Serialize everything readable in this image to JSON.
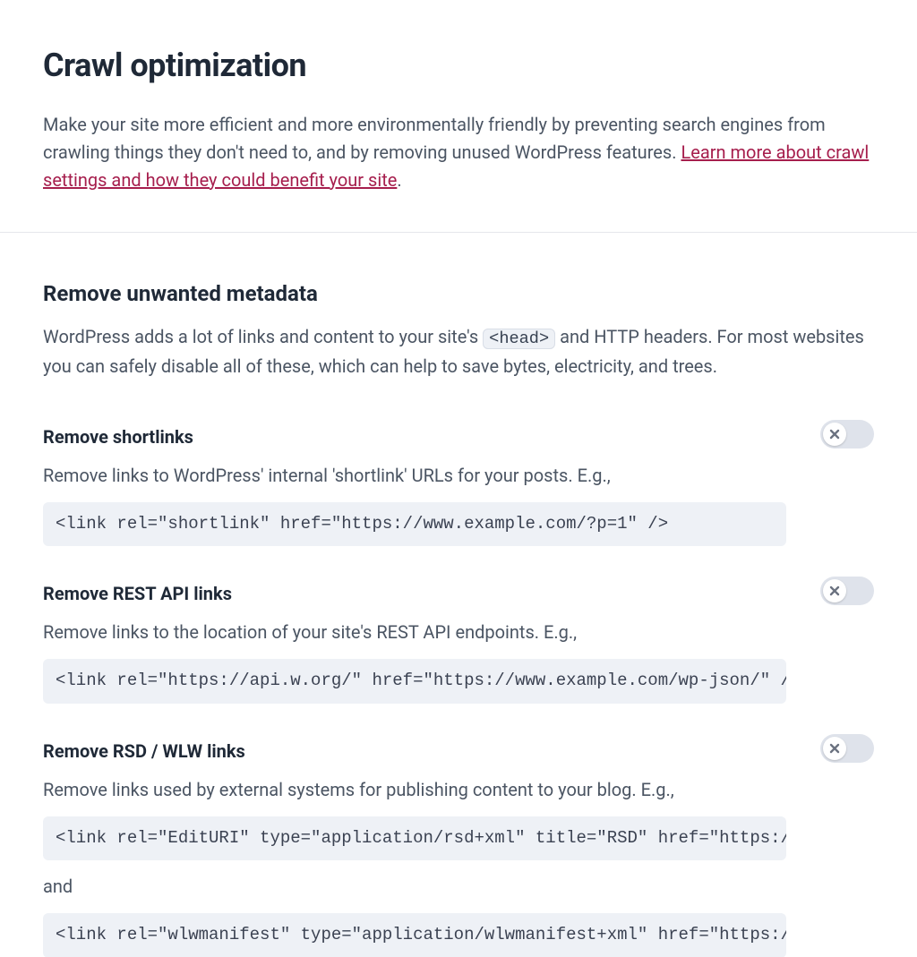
{
  "header": {
    "title": "Crawl optimization",
    "intro_pre": "Make your site more efficient and more environmentally friendly by preventing search engines from crawling things they don't need to, and by removing unused WordPress features. ",
    "learn_more": "Learn more about crawl settings and how they could benefit your site",
    "period": "."
  },
  "section": {
    "title": "Remove unwanted metadata",
    "intro_pre": "WordPress adds a lot of links and content to your site's ",
    "head_tag": "<head>",
    "intro_post": " and HTTP headers. For most websites you can safely disable all of these, which can help to save bytes, electricity, and trees."
  },
  "settings": [
    {
      "title": "Remove shortlinks",
      "desc": "Remove links to WordPress' internal 'shortlink' URLs for your posts. E.g.,",
      "code1": "<link rel=\"shortlink\" href=\"https://www.example.com/?p=1\" />",
      "and": "",
      "code2": "",
      "enabled": false
    },
    {
      "title": "Remove REST API links",
      "desc": "Remove links to the location of your site's REST API endpoints. E.g.,",
      "code1": "<link rel=\"https://api.w.org/\" href=\"https://www.example.com/wp-json/\" />",
      "and": "",
      "code2": "",
      "enabled": false
    },
    {
      "title": "Remove RSD / WLW links",
      "desc": "Remove links used by external systems for publishing content to your blog. E.g.,",
      "code1": "<link rel=\"EditURI\" type=\"application/rsd+xml\" title=\"RSD\" href=\"https://www.",
      "and": "and",
      "code2": "<link rel=\"wlwmanifest\" type=\"application/wlwmanifest+xml\" href=\"https://www.",
      "enabled": false
    }
  ]
}
